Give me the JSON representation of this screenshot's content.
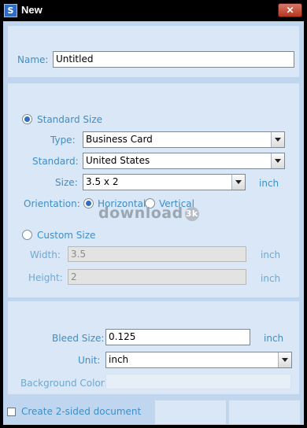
{
  "window": {
    "icon": "S",
    "title": "New",
    "close_glyph": "✕"
  },
  "name": {
    "label": "Name:",
    "value": "Untitled"
  },
  "standard_size": {
    "label": "Standard Size",
    "selected": true,
    "type_label": "Type:",
    "type_value": "Business Card",
    "standard_label": "Standard:",
    "standard_value": "United States",
    "size_label": "Size:",
    "size_value": "3.5 x 2",
    "size_unit": "inch",
    "orientation_label": "Orientation:",
    "horizontal_label": "Horizontal",
    "vertical_label": "Vertical",
    "orientation_selected": "Horizontal"
  },
  "watermark": {
    "text": "download",
    "badge": "3k"
  },
  "custom_size": {
    "label": "Custom Size",
    "selected": false,
    "width_label": "Width:",
    "width_value": "3.5",
    "width_unit": "inch",
    "height_label": "Height:",
    "height_value": "2",
    "height_unit": "inch"
  },
  "bleed": {
    "bleed_label": "Bleed Size:",
    "bleed_value": "0.125",
    "bleed_unit": "inch",
    "unit_label": "Unit:",
    "unit_value": "inch",
    "background_label": "Background Color:"
  },
  "footer": {
    "two_sided_label": "Create 2-sided document",
    "two_sided_checked": false
  },
  "colors": {
    "label_blue": "#3f8dc8",
    "panel_bg": "#d9e7f7",
    "client_bg": "#c0d6ee",
    "close_red": "#c0392b"
  }
}
